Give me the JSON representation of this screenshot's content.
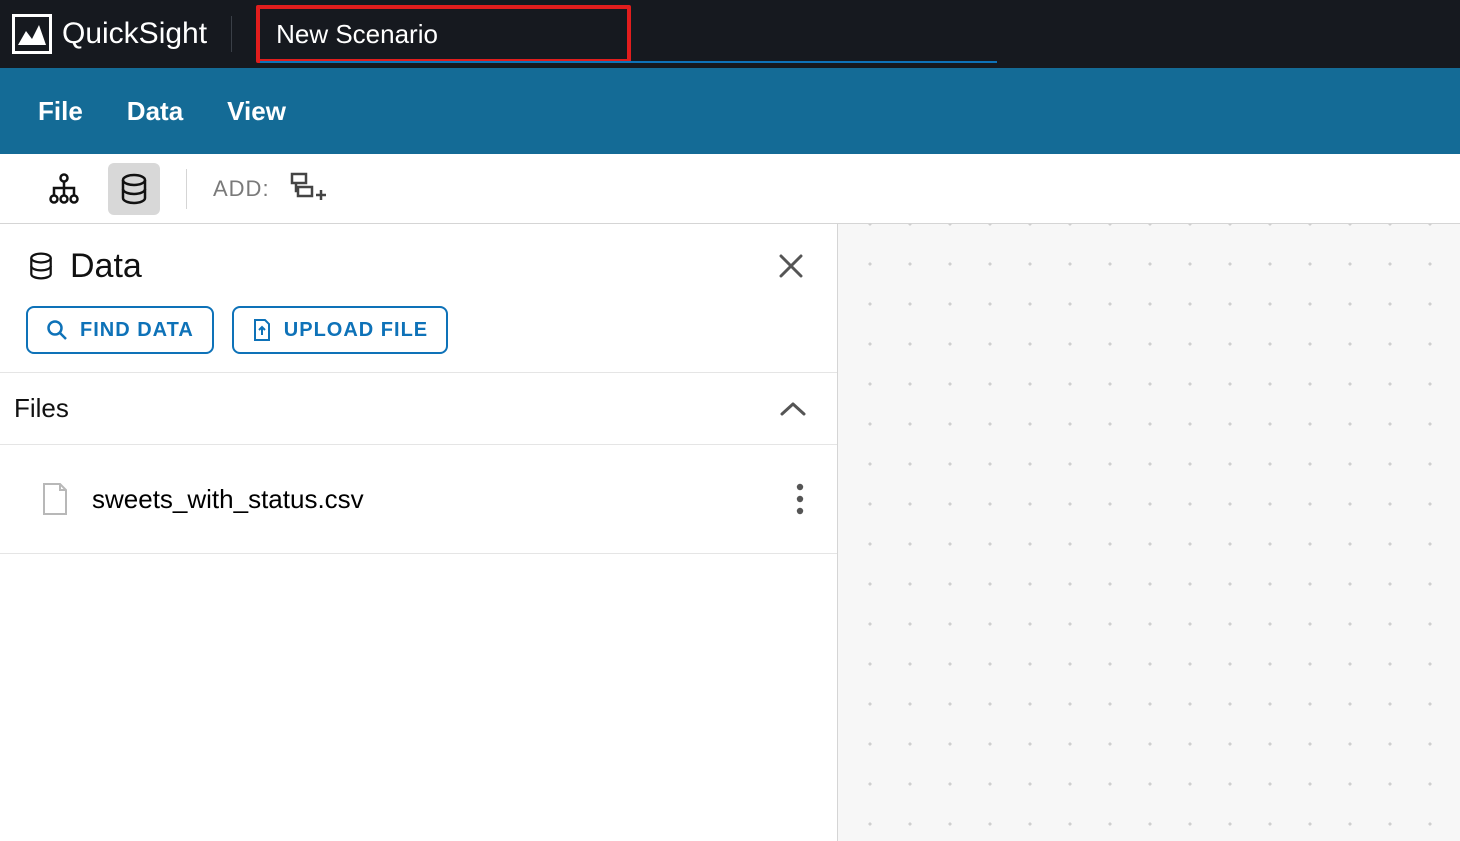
{
  "brand": {
    "name": "QuickSight"
  },
  "scenario": {
    "name": "New Scenario"
  },
  "menubar": {
    "file": "File",
    "data": "Data",
    "view": "View"
  },
  "toolbar": {
    "add_label": "ADD:"
  },
  "panel": {
    "title": "Data",
    "find_data_label": "FIND DATA",
    "upload_file_label": "UPLOAD FILE"
  },
  "files": {
    "section_label": "Files",
    "items": [
      {
        "name": "sweets_with_status.csv"
      }
    ]
  }
}
